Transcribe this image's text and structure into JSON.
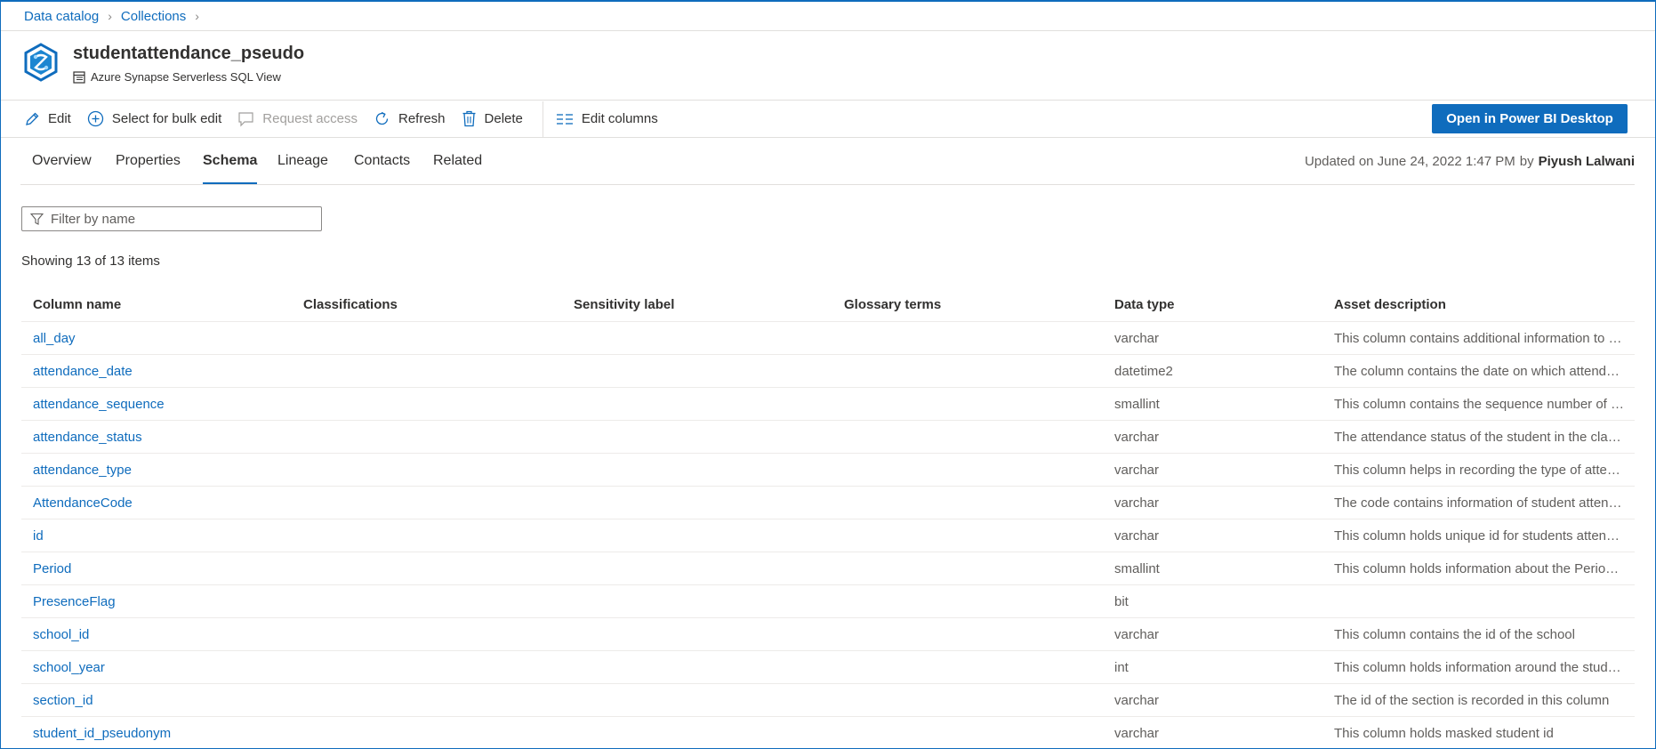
{
  "breadcrumb": {
    "items": [
      "Data catalog",
      "Collections"
    ]
  },
  "asset": {
    "title": "studentattendance_pseudo",
    "type": "Azure Synapse Serverless SQL View"
  },
  "toolbar": {
    "edit": "Edit",
    "bulk_edit": "Select for bulk edit",
    "request_access": "Request access",
    "refresh": "Refresh",
    "delete": "Delete",
    "edit_columns": "Edit columns",
    "open_powerbi": "Open in Power BI Desktop"
  },
  "tabs": [
    "Overview",
    "Properties",
    "Schema",
    "Lineage",
    "Contacts",
    "Related"
  ],
  "active_tab": "Schema",
  "updated": {
    "text": "Updated on June 24, 2022 1:47 PM",
    "by": "by",
    "name": "Piyush Lalwani"
  },
  "filter": {
    "placeholder": "Filter by name",
    "value": ""
  },
  "showing": "Showing 13 of 13 items",
  "table": {
    "columns": [
      "Column name",
      "Classifications",
      "Sensitivity label",
      "Glossary terms",
      "Data type",
      "Asset description"
    ],
    "rows": [
      {
        "name": "all_day",
        "type": "varchar",
        "desc": "This column contains additional information to understand whether the attendance is for all day"
      },
      {
        "name": "attendance_date",
        "type": "datetime2",
        "desc": "The column contains the date on which attendance was recorded"
      },
      {
        "name": "attendance_sequence",
        "type": "smallint",
        "desc": "This column contains the sequence number of attendance records"
      },
      {
        "name": "attendance_status",
        "type": "varchar",
        "desc": "The attendance status of the student in the class is recorded here"
      },
      {
        "name": "attendance_type",
        "type": "varchar",
        "desc": "This column helps in recording the type of attendance"
      },
      {
        "name": "AttendanceCode",
        "type": "varchar",
        "desc": "The code contains information of student attendance"
      },
      {
        "name": "id",
        "type": "varchar",
        "desc": "This column holds unique id for students attendance records"
      },
      {
        "name": "Period",
        "type": "smallint",
        "desc": "This column holds information about the Period of the class"
      },
      {
        "name": "PresenceFlag",
        "type": "bit",
        "desc": ""
      },
      {
        "name": "school_id",
        "type": "varchar",
        "desc": "This column contains the id of the school"
      },
      {
        "name": "school_year",
        "type": "int",
        "desc": "This column holds information around the student school year"
      },
      {
        "name": "section_id",
        "type": "varchar",
        "desc": "The id of the section is recorded in this column"
      },
      {
        "name": "student_id_pseudonym",
        "type": "varchar",
        "desc": "This column holds masked student id"
      }
    ]
  },
  "colors": {
    "accent": "#0f6cbd",
    "text": "#323130",
    "muted": "#605e5c",
    "border": "#e1dfdd"
  },
  "icons": {
    "asset": "synapse-hexagon-icon",
    "sub": "sql-view-icon",
    "edit": "pencil-icon",
    "bulk": "plus-circle-icon",
    "request": "comment-icon",
    "refresh": "refresh-icon",
    "delete": "trash-icon",
    "columns": "columns-icon",
    "filter": "filter-icon"
  }
}
